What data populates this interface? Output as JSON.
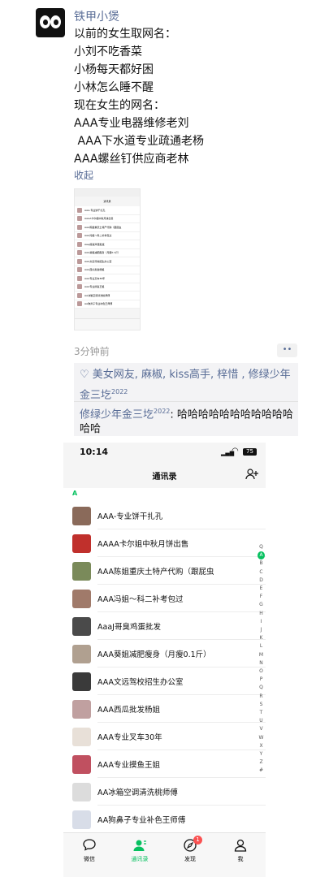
{
  "post": {
    "author": "铁甲小煲",
    "lines": [
      "以前的女生取网名：",
      "小刘不吃香菜",
      "小杨每天都好困",
      "小林怎么睡不醒",
      "现在女生的网名：",
      "AAA专业电器维修老刘",
      " AAA下水道专业疏通老杨",
      "AAA螺丝钉供应商老林"
    ],
    "collapse_label": "收起",
    "time": "3分钟前",
    "more_label": "••"
  },
  "comments": {
    "likes_icon": "heart-icon",
    "likes_text": "美女网友, 麻椒, kiss高手, 梓惜 , 修绿少年金三圪",
    "likes_sup": "2022",
    "reply_name": "修绿少年金三圪",
    "reply_sup": "2022",
    "reply_text": ": 哈哈哈哈哈哈哈哈哈哈哈哈哈"
  },
  "thumbnail": {
    "title": "通讯录",
    "items": [
      "AAA-专业饼干扎孔",
      "AAAA卡尔姐中秋月饼出售",
      "AAA陈姐重庆土特产代购（跟屁虫",
      "AAA冯姐～科二补考包过",
      "AaaJ哥臭鸡蛋批发",
      "AAA葵姐减肥瘦身（月瘦0.1斤）",
      "AAA文远驾校招生办公室",
      "AAA西瓜批发杨姐",
      "AAA专业叉车30年",
      "AAA专业摸鱼王姐",
      "AA冰箱空调清洗桃师傅",
      "AA狗鼻子专业补色王师傅"
    ]
  },
  "phone": {
    "status_time": "10:14",
    "battery": "75",
    "title": "通讯录",
    "section": "A",
    "contacts": [
      "AAA-专业饼干扎孔",
      "AAAA卡尔姐中秋月饼出售",
      "AAA陈姐重庆土特产代购（跟屁虫",
      "AAA冯姐～科二补考包过",
      "AaaJ哥臭鸡蛋批发",
      "AAA葵姐减肥瘦身（月瘦0.1斤）",
      "AAA文远驾校招生办公室",
      "AAA西瓜批发杨姐",
      "AAA专业叉车30年",
      "AAA专业摸鱼王姐",
      "AA冰箱空调清洗桃师傅",
      "AA狗鼻子专业补色王师傅"
    ],
    "index": [
      "Q",
      "A",
      "B",
      "C",
      "D",
      "E",
      "F",
      "G",
      "H",
      "I",
      "J",
      "K",
      "L",
      "M",
      "N",
      "O",
      "P",
      "Q",
      "R",
      "S",
      "T",
      "U",
      "V",
      "W",
      "X",
      "Y",
      "Z",
      "#"
    ],
    "tabs": [
      "微信",
      "通讯录",
      "发现",
      "我"
    ],
    "badge": "1",
    "accent": "#07c160"
  }
}
